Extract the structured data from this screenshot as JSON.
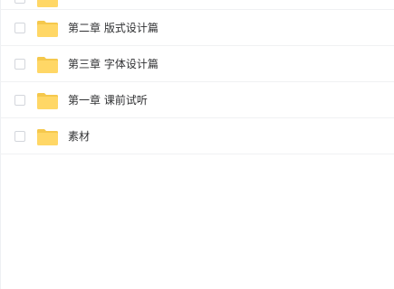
{
  "file_list": {
    "items": [
      {
        "name": "",
        "icon": "folder-icon"
      },
      {
        "name": "第二章 版式设计篇",
        "icon": "folder-icon"
      },
      {
        "name": "第三章 字体设计篇",
        "icon": "folder-icon"
      },
      {
        "name": "第一章 课前试听",
        "icon": "folder-icon"
      },
      {
        "name": "素材",
        "icon": "folder-icon"
      }
    ]
  },
  "colors": {
    "folder": "#ffd766",
    "folder_tab": "#f5c84c",
    "checkbox_border": "#d3d6dc",
    "row_divider": "#f0f1f3",
    "text": "#303133"
  }
}
